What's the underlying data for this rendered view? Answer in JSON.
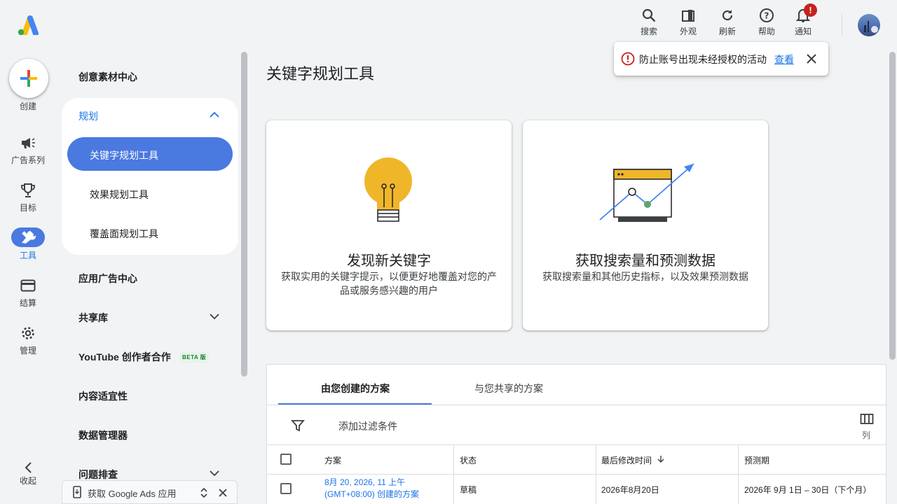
{
  "rail": {
    "create": "创建",
    "campaigns": "广告系列",
    "goals": "目标",
    "tools": "工具",
    "billing": "结算",
    "admin": "管理",
    "collapse": "收起"
  },
  "sidebar": {
    "creative_center": "创意素材中心",
    "planning": "规划",
    "keyword_planner": "关键字规划工具",
    "performance_planner": "效果规划工具",
    "reach_planner": "覆盖面规划工具",
    "app_center": "应用广告中心",
    "shared_library": "共享库",
    "youtube_creators": "YouTube 创作者合作",
    "beta": "BETA 版",
    "content_suitability": "内容适宜性",
    "data_manager": "数据管理器",
    "troubleshooting": "问题排查"
  },
  "topbar": {
    "search": "搜索",
    "appearance": "外观",
    "refresh": "刷新",
    "help": "帮助",
    "notifications": "通知",
    "badge": "!"
  },
  "toast": {
    "message": "防止账号出现未经授权的活动",
    "action": "查看"
  },
  "page": {
    "title": "关键字规划工具"
  },
  "cards": [
    {
      "title": "发现新关键字",
      "desc": "获取实用的关键字提示，以便更好地覆盖对您的产品或服务感兴趣的用户"
    },
    {
      "title": "获取搜索量和预测数据",
      "desc": "获取搜索量和其他历史指标，以及效果预测数据"
    }
  ],
  "plans": {
    "tabs": [
      "由您创建的方案",
      "与您共享的方案"
    ],
    "filter": "添加过滤条件",
    "columns_label": "列",
    "headers": [
      "方案",
      "状态",
      "最后修改时间",
      "预测期"
    ],
    "rows": [
      {
        "plan": "8月 20, 2026, 11 上午 (GMT+08:00) 创建的方案",
        "status": "草稿",
        "modified": "2026年8月20日",
        "forecast": "2026年 9月 1日 – 30日（下个月）"
      }
    ]
  },
  "promo": {
    "text": "获取 Google Ads 应用"
  },
  "colors": {
    "accent": "#4a79e0",
    "link": "#1a73e8",
    "warning": "#c5221f"
  }
}
